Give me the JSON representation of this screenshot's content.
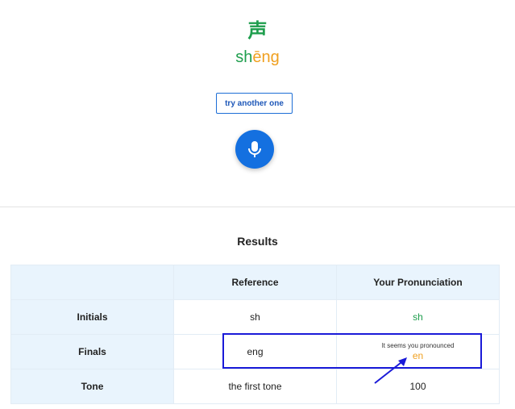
{
  "card": {
    "hanzi": "声",
    "pinyin_initial": "sh",
    "pinyin_final": "ēng"
  },
  "buttons": {
    "try_another": "try another one",
    "mic_icon": "microphone-icon"
  },
  "results": {
    "title": "Results",
    "headers": [
      "",
      "Reference",
      "Your Pronunciation"
    ],
    "rows": [
      {
        "label": "Initials",
        "reference": "sh",
        "yours": "sh",
        "hint": ""
      },
      {
        "label": "Finals",
        "reference": "eng",
        "yours": "en",
        "hint": "It seems you pronounced"
      },
      {
        "label": "Tone",
        "reference": "the first tone",
        "yours": "100",
        "hint": ""
      }
    ]
  },
  "colors": {
    "correct": "#1e9e4d",
    "incorrect": "#f0a020",
    "accent": "#1470e0",
    "annotation": "#1a1ad8"
  }
}
